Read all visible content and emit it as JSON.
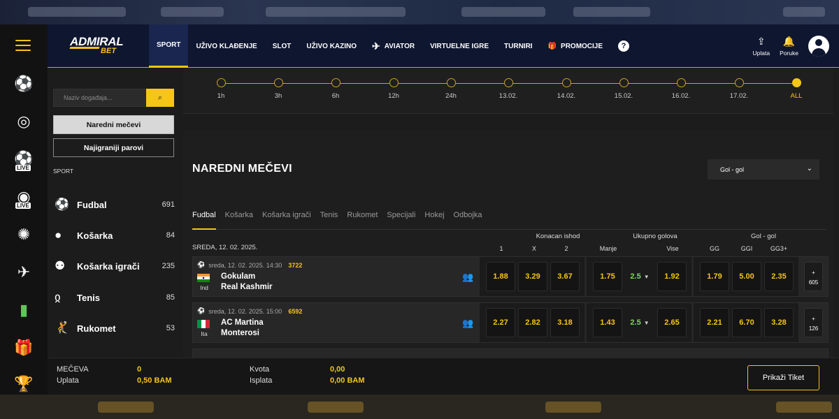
{
  "topnav": {
    "logo_top": "ADMIRAL",
    "logo_bottom": "BET",
    "items": [
      "SPORT",
      "UŽIVO KLAĐENJE",
      "SLOT",
      "UŽIVO KAZINO",
      "AVIATOR",
      "VIRTUELNE IGRE",
      "TURNIRI",
      "PROMOCIJE"
    ],
    "help": "?",
    "deposit": "Uplata",
    "messages": "Poruke"
  },
  "rail": {
    "live_tag": "LIVE"
  },
  "sidebar": {
    "search_placeholder": "Naziv događaja...",
    "btn_next": "Naredni mečevi",
    "btn_popular": "Najigraniji parovi",
    "section": "SPORT",
    "sports": [
      {
        "name": "Fudbal",
        "count": "691",
        "icon": "soccer-ball-icon"
      },
      {
        "name": "Košarka",
        "count": "84",
        "icon": "basketball-icon"
      },
      {
        "name": "Košarka igrači",
        "count": "235",
        "icon": "basketball-players-icon"
      },
      {
        "name": "Tenis",
        "count": "85",
        "icon": "tennis-icon"
      },
      {
        "name": "Rukomet",
        "count": "53",
        "icon": "handball-icon"
      }
    ]
  },
  "timeline": {
    "points": [
      "1h",
      "3h",
      "6h",
      "12h",
      "24h",
      "13.02.",
      "14.02.",
      "15.02.",
      "16.02.",
      "17.02.",
      "ALL"
    ],
    "active": "ALL"
  },
  "main": {
    "title": "NAREDNI MEČEVI",
    "market_select": "Gol - gol",
    "tabs": [
      "Fudbal",
      "Košarka",
      "Košarka igrači",
      "Tenis",
      "Rukomet",
      "Specijali",
      "Hokej",
      "Odbojka"
    ],
    "groups": {
      "g1": "Konacan ishod",
      "g2": "Ukupno golova",
      "g3": "Gol - gol"
    },
    "columns": {
      "c1": "1",
      "cx": "X",
      "c2": "2",
      "under": "Manje",
      "over": "Vise",
      "gg": "GG",
      "ggi": "GGI",
      "gg3": "GG3+"
    },
    "date_header": "SREDA, 12. 02. 2025.",
    "matches": [
      {
        "time": "sreda, 12. 02. 2025. 14:30",
        "id": "3722",
        "country": "Ind",
        "home": "Gokulam",
        "away": "Real Kashmir",
        "o1": "1.88",
        "ox": "3.29",
        "o2": "3.67",
        "under": "1.75",
        "line": "2.5",
        "over": "1.92",
        "gg": "1.79",
        "ggi": "5.00",
        "gg3": "2.35",
        "more_plus": "+",
        "more": "605"
      },
      {
        "time": "sreda, 12. 02. 2025. 15:00",
        "id": "6592",
        "country": "Ita",
        "home": "AC Martina",
        "away": "Monterosi",
        "o1": "2.27",
        "ox": "2.82",
        "o2": "3.18",
        "under": "1.43",
        "line": "2.5",
        "over": "2.65",
        "gg": "2.21",
        "ggi": "6.70",
        "gg3": "3.28",
        "more_plus": "+",
        "more": "126"
      }
    ]
  },
  "footer": {
    "matches_label": "MEČEVA",
    "matches_value": "0",
    "stake_label": "Uplata",
    "stake_value": "0,50 BAM",
    "odds_label": "Kvota",
    "odds_value": "0,00",
    "payout_label": "Isplata",
    "payout_value": "0,00 BAM",
    "ticket_button": "Prikaži Tiket"
  }
}
